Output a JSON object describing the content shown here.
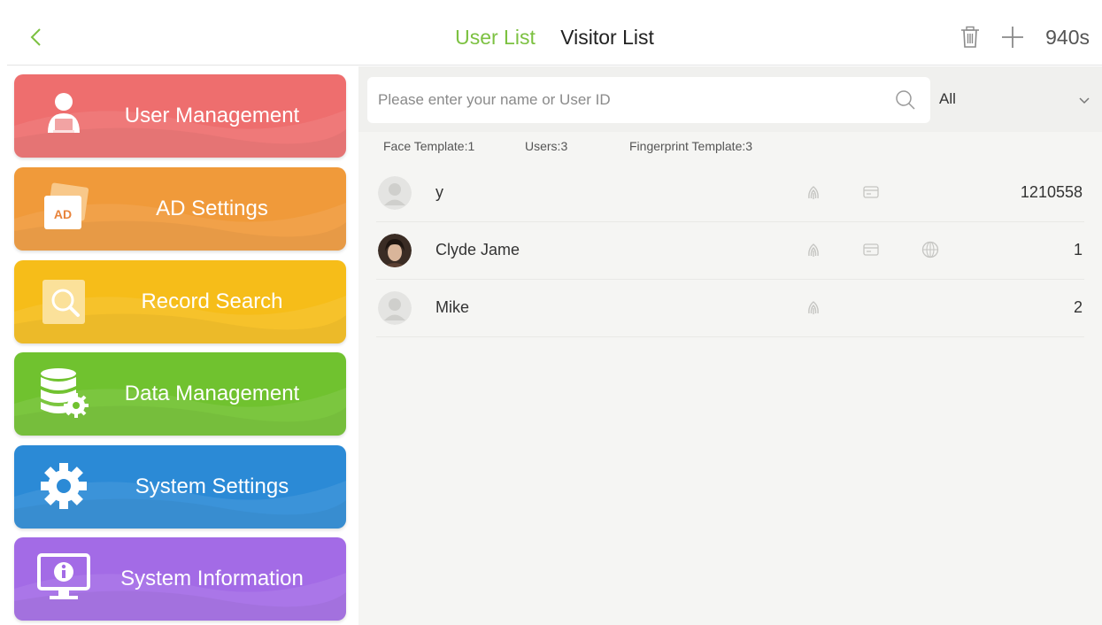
{
  "header": {
    "tabs": [
      {
        "label": "User List",
        "active": true
      },
      {
        "label": "Visitor List",
        "active": false
      }
    ],
    "timer": "940s",
    "icons": [
      "back-icon",
      "trash-icon",
      "plus-icon"
    ]
  },
  "sidebar": {
    "items": [
      {
        "label": "User Management",
        "icon": "user-icon",
        "color": "#ee6e6e"
      },
      {
        "label": "AD Settings",
        "icon": "ad-icon",
        "color": "#f09a3a",
        "icon_text": "AD"
      },
      {
        "label": "Record Search",
        "icon": "record-search-icon",
        "color": "#f6bd19"
      },
      {
        "label": "Data Management",
        "icon": "database-icon",
        "color": "#70c22f"
      },
      {
        "label": "System Settings",
        "icon": "gear-icon",
        "color": "#2b8ad6"
      },
      {
        "label": "System Information",
        "icon": "monitor-info-icon",
        "color": "#a36be6"
      }
    ]
  },
  "search": {
    "placeholder": "Please enter your name or User ID",
    "value": ""
  },
  "filter": {
    "selected": "All"
  },
  "stats": {
    "face": "Face Template:1",
    "users": "Users:3",
    "fingerprint": "Fingerprint Template:3"
  },
  "users": [
    {
      "name": "y",
      "id": "1210558",
      "fingerprint": true,
      "card": true,
      "face": false,
      "photo": false
    },
    {
      "name": "Clyde Jame",
      "id": "1",
      "fingerprint": true,
      "card": true,
      "face": true,
      "photo": true
    },
    {
      "name": "Mike",
      "id": "2",
      "fingerprint": true,
      "card": false,
      "face": false,
      "photo": false
    }
  ],
  "colors": {
    "accent": "#7cc141"
  }
}
